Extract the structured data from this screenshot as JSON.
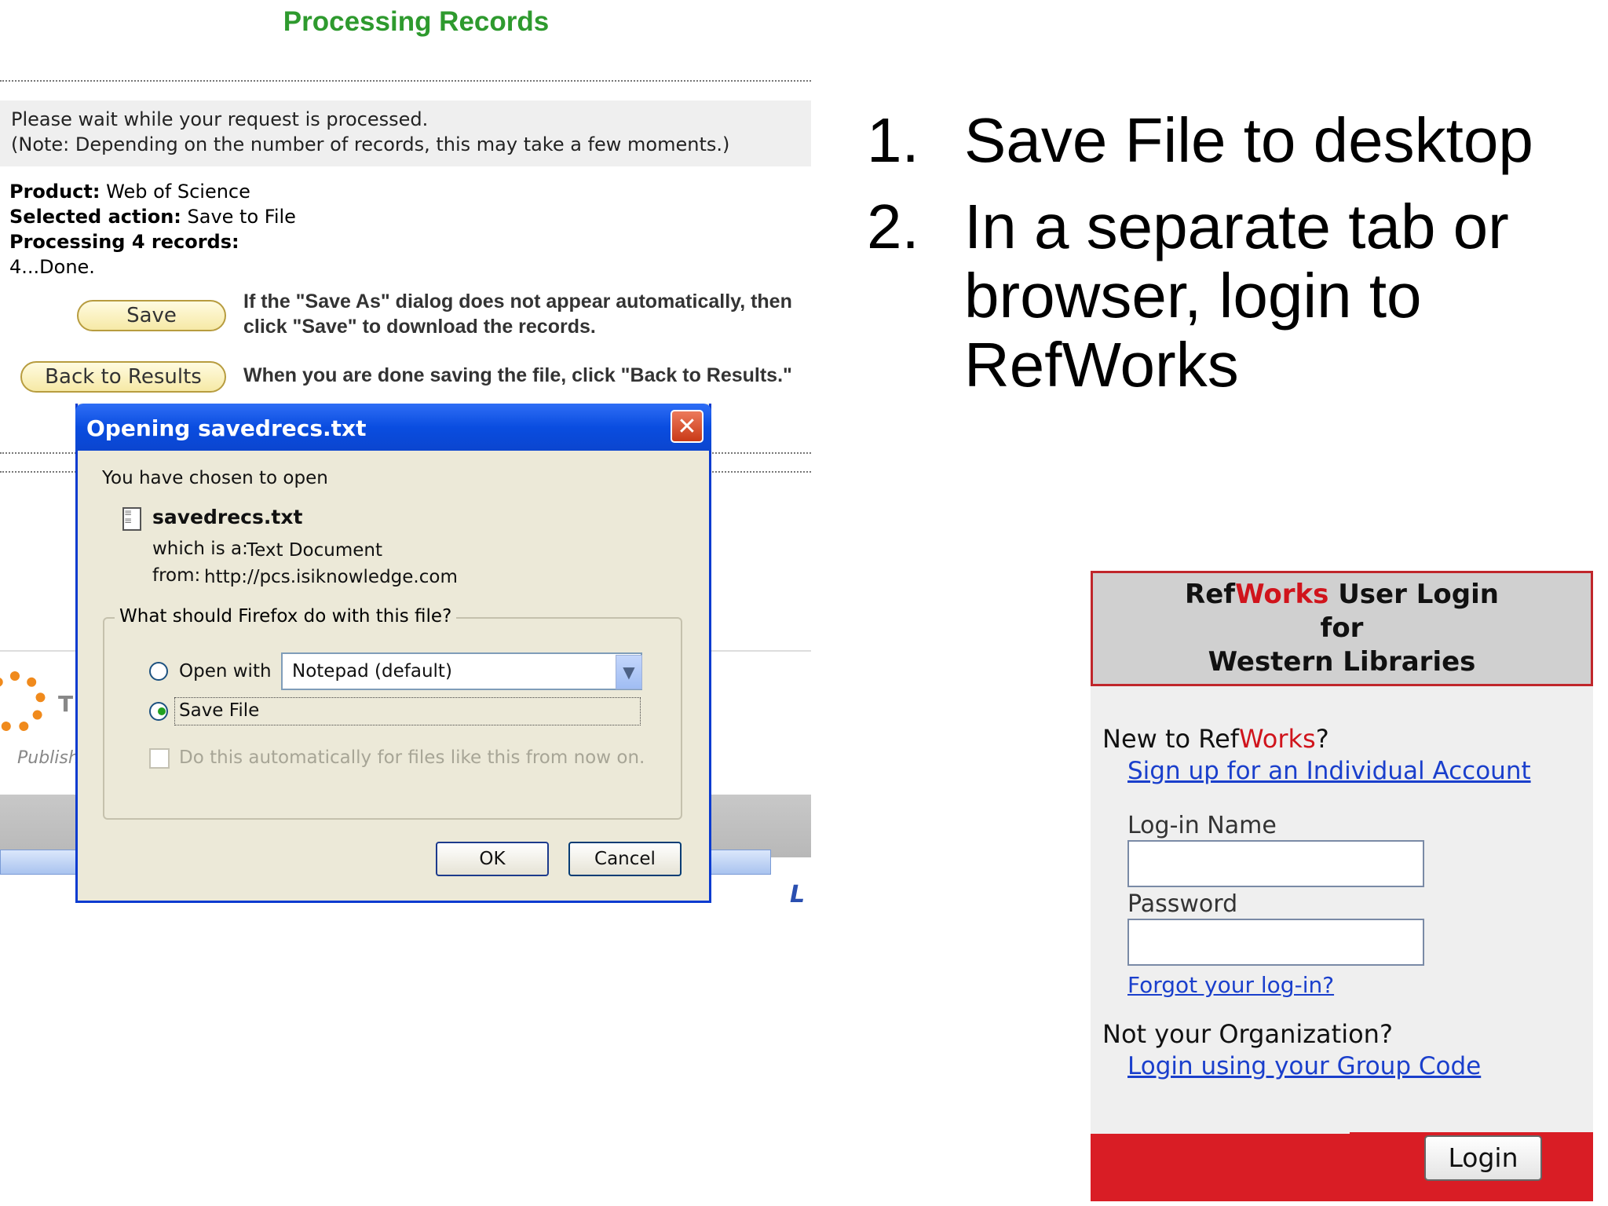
{
  "left_screen": {
    "title": "Processing Records",
    "wait_line1": "Please wait while your request is processed.",
    "wait_line2": "(Note: Depending on the number of records, this may take a few moments.)",
    "product_label": "Product:",
    "product_value": "Web of Science",
    "action_label": "Selected action:",
    "action_value": "Save to File",
    "processing_label": "Processing 4 records:",
    "progress": "4...Done.",
    "save_button": "Save",
    "save_help": "If the \"Save As\" dialog does not appear automatically, then click \"Save\" to download the records.",
    "back_button": "Back to Results",
    "back_help": "When you are done saving the file, click \"Back to Results.\"",
    "logo_letter": "T",
    "publish_text": "Publish",
    "corner_glyph": "L"
  },
  "dialog": {
    "title": "Opening savedrecs.txt",
    "close_glyph": "✕",
    "chosen_text": "You have chosen to open",
    "file_name": "savedrecs.txt",
    "which_label": "which is a:",
    "which_value": "Text Document",
    "from_label": "from:",
    "from_value": "http://pcs.isiknowledge.com",
    "group_label": "What should Firefox do with this file?",
    "open_with_label": "Open with",
    "open_with_app": "Notepad (default)",
    "select_arrow": "▼",
    "save_file_label": "Save File",
    "save_file_selected": true,
    "auto_checkbox_label": "Do this automatically for files like this from now on.",
    "ok_label": "OK",
    "cancel_label": "Cancel",
    "icons": {
      "file": "text-file-icon",
      "close": "close-icon"
    }
  },
  "instructions": {
    "step1_num": "1.",
    "step1_text": "Save File to desktop",
    "step2_num": "2.",
    "step2_line1": "In a separate tab or",
    "step2_line2": "browser, login to",
    "step2_line3": "RefWorks"
  },
  "refworks": {
    "header_ref": "Ref",
    "header_works": "Works",
    "header_rest": " User Login",
    "header_for": "for",
    "header_org": "Western Libraries",
    "new_to": "New to Ref",
    "new_works": "Works",
    "new_q": "?",
    "signup_link": "Sign up for an Individual Account",
    "login_name_label": "Log-in Name",
    "login_name_value": "",
    "password_label": "Password",
    "password_value": "",
    "forgot_link": "Forgot your log-in?",
    "not_org": "Not your Organization?",
    "group_code_link": "Login using your Group Code",
    "login_button": "Login",
    "colors": {
      "brand_red": "#d0141c",
      "link_blue": "#1a3fcc"
    }
  }
}
